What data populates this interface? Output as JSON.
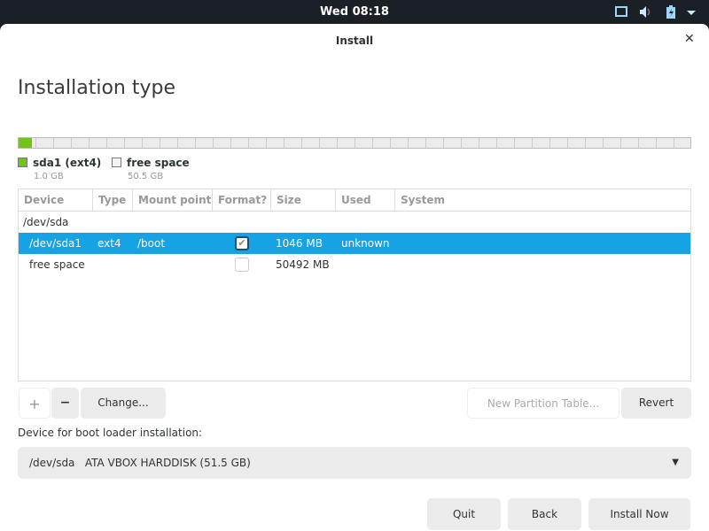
{
  "topbar": {
    "clock": "Wed 08:18"
  },
  "window": {
    "title": "Install",
    "heading": "Installation type"
  },
  "partition_bar": {
    "segments": [
      {
        "name": "sda1 (ext4)",
        "size": "1.0 GB",
        "color": "#73c41a",
        "fraction": 0.02
      },
      {
        "name": "free space",
        "size": "50.5 GB",
        "color": "#ececec",
        "fraction": 0.98
      }
    ]
  },
  "table": {
    "headers": [
      "Device",
      "Type",
      "Mount point",
      "Format?",
      "Size",
      "Used",
      "System"
    ],
    "group": "/dev/sda",
    "rows": [
      {
        "device": "/dev/sda1",
        "type": "ext4",
        "mount": "/boot",
        "format": true,
        "size": "1046 MB",
        "used": "unknown",
        "system": ""
      },
      {
        "device": "free space",
        "type": "",
        "mount": "",
        "format": false,
        "size": "50492 MB",
        "used": "",
        "system": ""
      }
    ]
  },
  "buttons": {
    "add": "+",
    "remove": "−",
    "change": "Change...",
    "new_table": "New Partition Table...",
    "revert": "Revert",
    "quit": "Quit",
    "back": "Back",
    "install": "Install Now"
  },
  "bootloader": {
    "label": "Device for boot loader installation:",
    "value": "/dev/sda   ATA VBOX HARDDISK (51.5 GB)"
  }
}
